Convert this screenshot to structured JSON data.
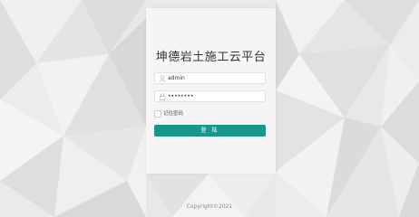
{
  "app": {
    "title": "坤德岩土施工云平台"
  },
  "login": {
    "username_value": "admin",
    "password_value": "••••••••",
    "remember_label": "记住密码",
    "submit_label": "登 陆"
  },
  "footer": {
    "copyright": "Copyright©2021"
  },
  "colors": {
    "accent": "#16978a",
    "background": "#e9e9e9",
    "card": "#fafafa"
  },
  "icons": {
    "username": "user-icon",
    "password": "lock-icon"
  }
}
